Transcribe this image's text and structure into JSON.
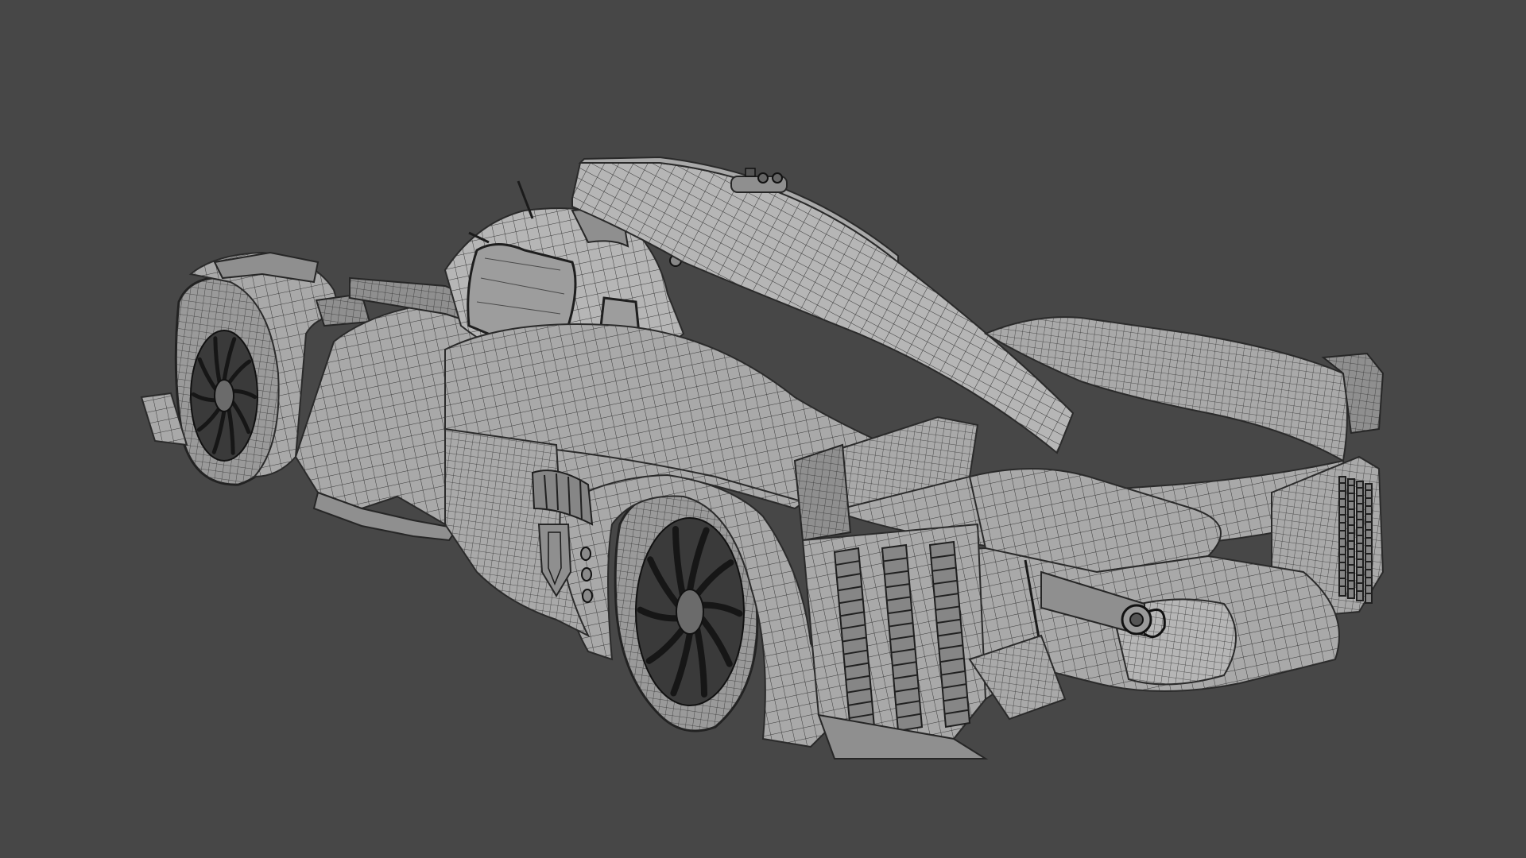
{
  "viewport": {
    "background_color": "#474747",
    "mesh_color": "#a9a9a9",
    "wire_color": "#2a2a2a"
  },
  "model": {
    "subject": "racing-car-wireframe-mesh",
    "view": "rear-three-quarter",
    "wheel_spokes": 10
  }
}
